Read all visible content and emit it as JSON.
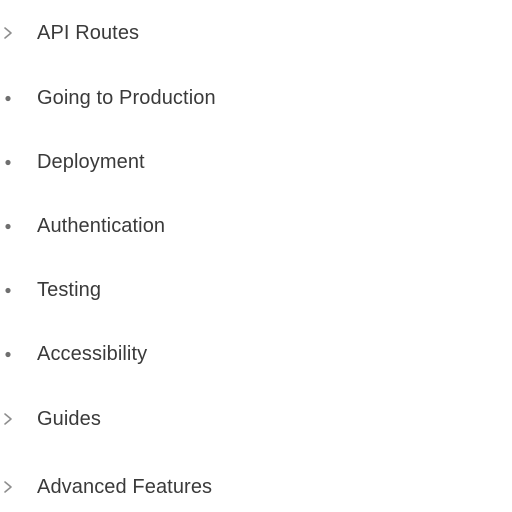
{
  "sidebar": {
    "items": [
      {
        "label": "API Routes",
        "marker": "chevron-right-icon"
      },
      {
        "label": "Going to Production",
        "marker": "bullet-icon"
      },
      {
        "label": "Deployment",
        "marker": "bullet-icon"
      },
      {
        "label": "Authentication",
        "marker": "bullet-icon"
      },
      {
        "label": "Testing",
        "marker": "bullet-icon"
      },
      {
        "label": "Accessibility",
        "marker": "bullet-icon"
      },
      {
        "label": "Guides",
        "marker": "chevron-right-icon"
      },
      {
        "label": "Advanced Features",
        "marker": "chevron-right-icon"
      }
    ]
  },
  "colors": {
    "text": "#3a3a3a",
    "chevron": "#8e8e8e",
    "bullet": "#6f6f6f",
    "background": "#ffffff"
  }
}
